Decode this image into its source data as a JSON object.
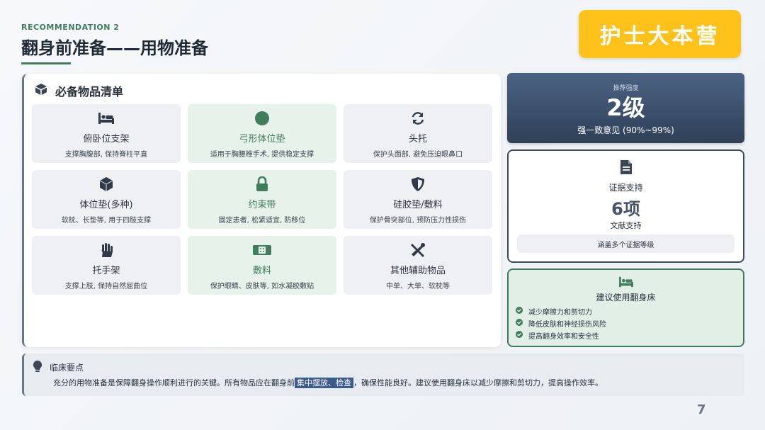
{
  "header": {
    "kicker": "RECOMMENDATION 2",
    "title": "翻身前准备——用物准备",
    "brand": "护士大本营"
  },
  "panel": {
    "heading": "必备物品清单",
    "items": [
      {
        "name": "俯卧位支架",
        "desc": "支撑胸腹部, 保持脊柱平直",
        "icon": "bed-icon"
      },
      {
        "name": "弓形体位垫",
        "desc": "适用于胸腰椎手术, 提供稳定支撑",
        "icon": "circle-icon"
      },
      {
        "name": "头托",
        "desc": "保护头面部, 避免压迫眼鼻口",
        "icon": "sync-icon"
      },
      {
        "name": "体位垫(多种)",
        "desc": "软枕、长垫等, 用于四肢支撑",
        "icon": "cube-icon"
      },
      {
        "name": "约束带",
        "desc": "固定患者, 松紧适宜, 防移位",
        "icon": "lock-icon"
      },
      {
        "name": "硅胶垫/敷料",
        "desc": "保护骨突部位, 预防压力性损伤",
        "icon": "shield-icon"
      },
      {
        "name": "托手架",
        "desc": "支撑上肢, 保持自然屈曲位",
        "icon": "hand-icon"
      },
      {
        "name": "敷料",
        "desc": "保护眼睛、皮肤等, 如水凝胶敷贴",
        "icon": "bandage-icon"
      },
      {
        "name": "其他辅助物品",
        "desc": "中单、大单、软枕等",
        "icon": "tools-icon"
      }
    ]
  },
  "recommendation": {
    "label": "推荐强度",
    "level": "2级",
    "consensus": "强一致意见 (90%~99%)"
  },
  "evidence": {
    "label": "证据支持",
    "count": "6项",
    "unit": "文献支持",
    "note": "涵盖多个证据等级"
  },
  "bed": {
    "heading": "建议使用翻身床",
    "points": [
      "减少摩擦力和剪切力",
      "降低皮肤和神经损伤风险",
      "提高翻身效率和安全性"
    ]
  },
  "note": {
    "heading": "临床要点",
    "text_before": "充分的用物准备是保障翻身操作顺利进行的关键。所有物品应在翻身前",
    "highlight": "集中摆放、检查",
    "text_after": "，确保性能良好。建议使用翻身床以减少摩擦和剪切力，提高操作效率。"
  },
  "page_number": "7",
  "colors": {
    "accent_green": "#3f7d5c",
    "navy": "#2f4058",
    "brand_yellow": "#ffc21a"
  }
}
